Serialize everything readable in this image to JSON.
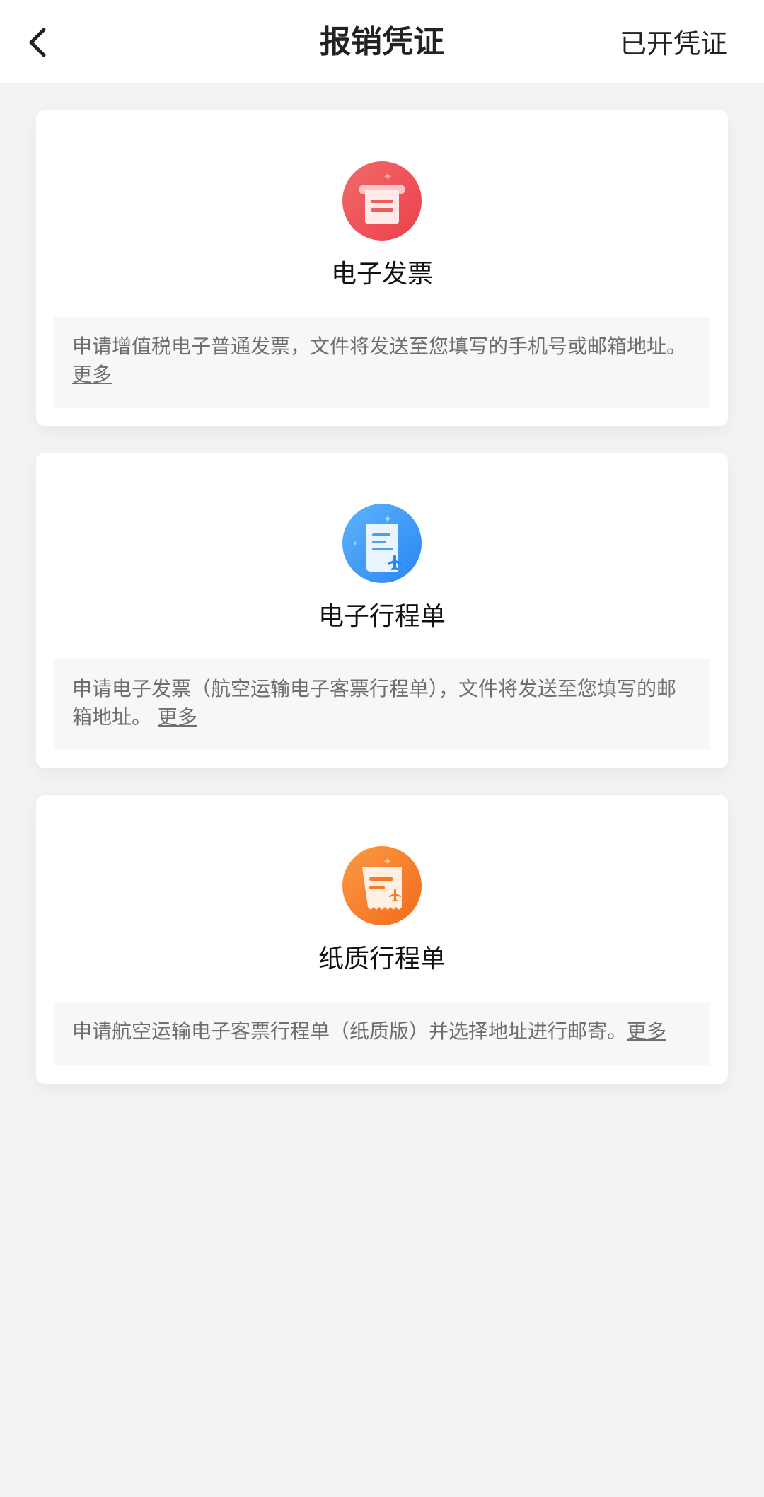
{
  "header": {
    "title": "报销凭证",
    "issued_label": "已开凭证",
    "back_icon": "chevron-left-icon"
  },
  "cards": [
    {
      "title": "电子发票",
      "description": "申请增值税电子普通发票，文件将发送至您填写的手机号或邮箱地址。",
      "more_label": "更多",
      "icon": "receipt-printer-icon",
      "icon_color": "#f04f4f"
    },
    {
      "title": "电子行程单",
      "description": "申请电子发票（航空运输电子客票行程单），文件将发送至您填写的邮箱地址。",
      "more_label": "更多",
      "icon": "itinerary-document-icon",
      "icon_color": "#2f8ff5"
    },
    {
      "title": "纸质行程单",
      "description": "申请航空运输电子客票行程单（纸质版）并选择地址进行邮寄。",
      "more_label": "更多",
      "icon": "paper-ticket-icon",
      "icon_color": "#f47a22"
    }
  ],
  "colors": {
    "background": "#f2f3f5",
    "card": "#ffffff",
    "description_box": "#f7f7f8",
    "text_secondary": "#6e6e6e"
  }
}
